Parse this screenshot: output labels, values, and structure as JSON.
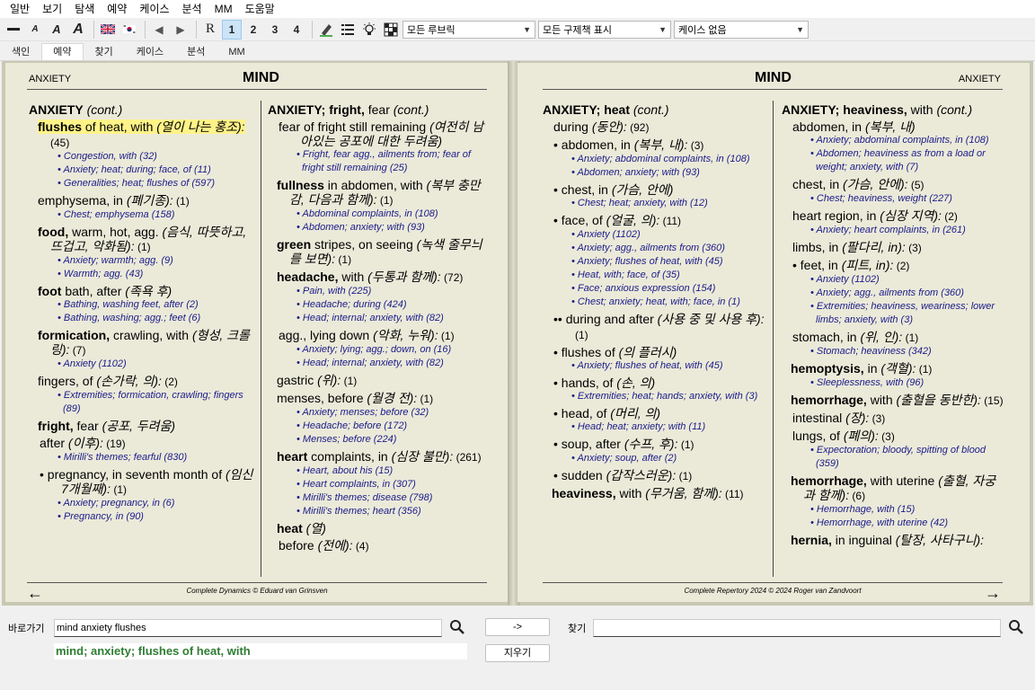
{
  "menu": [
    "일반",
    "보기",
    "탐색",
    "예약",
    "케이스",
    "분석",
    "MM",
    "도움말"
  ],
  "toolbar": {
    "r_label": "R",
    "num1": "1",
    "num2": "2",
    "num3": "3",
    "num4": "4",
    "rubric_filter": "모든 루브릭",
    "remedy_filter": "모든 구제책 표시",
    "case_select": "케이스 없음"
  },
  "tabs": [
    "색인",
    "예약",
    "찾기",
    "케이스",
    "분석",
    "MM"
  ],
  "left": {
    "header_small": "ANXIETY",
    "header_title": "MIND",
    "footer": "Complete Dynamics © Eduard van Grinsven",
    "col1": [
      {
        "t": "hd",
        "b": "ANXIETY",
        "r": " (cont.)"
      },
      {
        "t": "e",
        "hl": true,
        "b": "flushes",
        "p": " of heat, with ",
        "k": "(열이 나는 홍조):",
        "n": " (45)"
      },
      {
        "t": "x",
        "v": "• Congestion, with (32)"
      },
      {
        "t": "x",
        "v": "• Anxiety; heat; during; face, of (11)"
      },
      {
        "t": "x",
        "v": "• Generalities; heat; flushes of (597)"
      },
      {
        "t": "e",
        "p": "emphysema, in ",
        "k": "(폐기종):",
        "n": " (1)"
      },
      {
        "t": "x",
        "v": "• Chest; emphysema (158)"
      },
      {
        "t": "e",
        "b": "food,",
        "p": " warm, hot, agg. ",
        "k": "(음식, 따뜻하고, 뜨겁고, 악화됨):",
        "n": " (1)"
      },
      {
        "t": "x",
        "v": "• Anxiety; warmth; agg. (9)"
      },
      {
        "t": "x",
        "v": "• Warmth; agg. (43)"
      },
      {
        "t": "e",
        "b": "foot",
        "p": " bath, after ",
        "k": "(족욕 후)"
      },
      {
        "t": "x",
        "v": "• Bathing, washing feet, after (2)"
      },
      {
        "t": "x",
        "v": "• Bathing, washing; agg.; feet (6)"
      },
      {
        "t": "e",
        "b": "formication,",
        "p": " crawling, with ",
        "k": "(형성, 크롤링):",
        "n": " (7)"
      },
      {
        "t": "x",
        "v": "• Anxiety (1102)"
      },
      {
        "t": "e",
        "p": "fingers, of ",
        "k": "(손가락, 의):",
        "n": " (2)"
      },
      {
        "t": "x",
        "v": "• Extremities; formication, crawling; fingers (89)"
      },
      {
        "t": "e",
        "b": "fright,",
        "p": " fear ",
        "k": "(공포, 두려움)"
      },
      {
        "t": "s",
        "p": "after ",
        "k": "(이후):",
        "n": " (19)"
      },
      {
        "t": "x",
        "v": "• Mirilli's themes; fearful (830)"
      },
      {
        "t": "s",
        "p": "• pregnancy, in seventh month of ",
        "k": "(임신 7개월째):",
        "n": " (1)"
      },
      {
        "t": "x",
        "v": "• Anxiety; pregnancy, in (6)"
      },
      {
        "t": "x",
        "v": "• Pregnancy, in (90)"
      }
    ],
    "col2": [
      {
        "t": "hd",
        "b": "ANXIETY; fright,",
        "p": " fear",
        "r": " (cont.)"
      },
      {
        "t": "s",
        "p": "fear of fright still remaining ",
        "k": "(여전히 남아있는 공포에 대한 두려움)"
      },
      {
        "t": "x",
        "v": "• Fright, fear agg., ailments from; fear of fright still remaining (25)"
      },
      {
        "t": "e",
        "b": "fullness",
        "p": " in abdomen, with ",
        "k": "(복부 충만감, 다음과 함께):",
        "n": " (1)"
      },
      {
        "t": "x",
        "v": "• Abdominal complaints, in (108)"
      },
      {
        "t": "x",
        "v": "• Abdomen; anxiety; with (93)"
      },
      {
        "t": "e",
        "b": "green",
        "p": " stripes, on seeing ",
        "k": "(녹색 줄무늬를 보면):",
        "n": " (1)"
      },
      {
        "t": "e",
        "b": "headache,",
        "p": " with ",
        "k": "(두통과 함께):",
        "n": " (72)"
      },
      {
        "t": "x",
        "v": "• Pain, with (225)"
      },
      {
        "t": "x",
        "v": "• Headache; during (424)"
      },
      {
        "t": "x",
        "v": "• Head; internal; anxiety, with (82)"
      },
      {
        "t": "s",
        "p": "agg., lying down ",
        "k": "(악화, 누워):",
        "n": " (1)"
      },
      {
        "t": "x",
        "v": "• Anxiety; lying; agg.; down, on (16)"
      },
      {
        "t": "x",
        "v": "• Head; internal; anxiety, with (82)"
      },
      {
        "t": "e",
        "p": "gastric ",
        "k": "(위):",
        "n": " (1)"
      },
      {
        "t": "e",
        "p": "menses, before ",
        "k": "(월경 전):",
        "n": " (1)"
      },
      {
        "t": "x",
        "v": "• Anxiety; menses; before (32)"
      },
      {
        "t": "x",
        "v": "• Headache; before (172)"
      },
      {
        "t": "x",
        "v": "• Menses; before (224)"
      },
      {
        "t": "e",
        "b": "heart",
        "p": " complaints, in ",
        "k": "(심장 불만):",
        "n": " (261)"
      },
      {
        "t": "x",
        "v": "• Heart, about his (15)"
      },
      {
        "t": "x",
        "v": "• Heart complaints, in (307)"
      },
      {
        "t": "x",
        "v": "• Mirilli's themes; disease (798)"
      },
      {
        "t": "x",
        "v": "• Mirilli's themes; heart (356)"
      },
      {
        "t": "e",
        "b": "heat",
        "k": " (열)"
      },
      {
        "t": "s",
        "p": "before ",
        "k": "(전에):",
        "n": " (4)"
      }
    ]
  },
  "right": {
    "header_small": "ANXIETY",
    "header_title": "MIND",
    "footer": "Complete Repertory 2024 © 2024 Roger van Zandvoort",
    "col1": [
      {
        "t": "hd",
        "b": "ANXIETY; heat",
        "r": " (cont.)"
      },
      {
        "t": "s",
        "p": "during ",
        "k": "(동안):",
        "n": " (92)"
      },
      {
        "t": "s",
        "p": "• abdomen, in ",
        "k": "(복부, 내):",
        "n": " (3)"
      },
      {
        "t": "x",
        "v": "• Anxiety; abdominal complaints, in (108)"
      },
      {
        "t": "x",
        "v": "• Abdomen; anxiety; with (93)"
      },
      {
        "t": "s",
        "p": "• chest, in ",
        "k": "(가슴, 안에)"
      },
      {
        "t": "x",
        "v": "• Chest; heat; anxiety, with (12)"
      },
      {
        "t": "s",
        "p": "• face, of ",
        "k": "(얼굴, 의):",
        "n": " (11)"
      },
      {
        "t": "x",
        "v": "• Anxiety (1102)"
      },
      {
        "t": "x",
        "v": "• Anxiety; agg., ailments from (360)"
      },
      {
        "t": "x",
        "v": "• Anxiety; flushes of heat, with (45)"
      },
      {
        "t": "x",
        "v": "• Heat, with; face, of (35)"
      },
      {
        "t": "x",
        "v": "• Face; anxious expression (154)"
      },
      {
        "t": "x",
        "v": "• Chest; anxiety; heat, with; face, in (1)"
      },
      {
        "t": "s",
        "p": "•• during and after ",
        "k": "(사용 중 및 사용 후):",
        "n": " (1)"
      },
      {
        "t": "s",
        "p": "• flushes of ",
        "k": "(의 플러시)"
      },
      {
        "t": "x",
        "v": "• Anxiety; flushes of heat, with (45)"
      },
      {
        "t": "s",
        "p": "• hands, of ",
        "k": "(손, 의)"
      },
      {
        "t": "x",
        "v": "• Extremities; heat; hands; anxiety, with (3)"
      },
      {
        "t": "s",
        "p": "• head, of ",
        "k": "(머리, 의)"
      },
      {
        "t": "x",
        "v": "• Head; heat; anxiety; with (11)"
      },
      {
        "t": "s",
        "p": "• soup, after ",
        "k": "(수프, 후):",
        "n": " (1)"
      },
      {
        "t": "x",
        "v": "• Anxiety; soup, after (2)"
      },
      {
        "t": "s",
        "p": "• sudden ",
        "k": "(갑작스러운):",
        "n": " (1)"
      },
      {
        "t": "e",
        "b": "heaviness,",
        "p": " with ",
        "k": "(무거움, 함께):",
        "n": "   (11)"
      }
    ],
    "col2": [
      {
        "t": "hd",
        "b": "ANXIETY; heaviness,",
        "p": " with",
        "r": " (cont.)"
      },
      {
        "t": "s",
        "p": "abdomen, in ",
        "k": "(복부, 내)"
      },
      {
        "t": "x",
        "v": "• Anxiety; abdominal complaints, in (108)"
      },
      {
        "t": "x",
        "v": "• Abdomen; heaviness as from a load or weight; anxiety, with (7)"
      },
      {
        "t": "s",
        "p": "chest, in ",
        "k": "(가슴, 안에):",
        "n": " (5)"
      },
      {
        "t": "x",
        "v": "• Chest; heaviness, weight (227)"
      },
      {
        "t": "s",
        "p": "heart region, in ",
        "k": "(심장 지역):",
        "n": " (2)"
      },
      {
        "t": "x",
        "v": "• Anxiety; heart complaints, in (261)"
      },
      {
        "t": "s",
        "p": "limbs, in ",
        "k": "(팔다리, in):",
        "n": " (3)"
      },
      {
        "t": "s",
        "p": "• feet, in ",
        "k": "(피트, in):",
        "n": " (2)"
      },
      {
        "t": "x",
        "v": "• Anxiety (1102)"
      },
      {
        "t": "x",
        "v": "• Anxiety; agg., ailments from (360)"
      },
      {
        "t": "x",
        "v": "• Extremities; heaviness, weariness; lower limbs; anxiety, with (3)"
      },
      {
        "t": "s",
        "p": "stomach, in ",
        "k": "(위, 인):",
        "n": " (1)"
      },
      {
        "t": "x",
        "v": "• Stomach; heaviness (342)"
      },
      {
        "t": "e",
        "b": "hemoptysis,",
        "p": " in ",
        "k": "(객혈):",
        "n": " (1)"
      },
      {
        "t": "x",
        "v": "• Sleeplessness, with (96)"
      },
      {
        "t": "e",
        "b": "hemorrhage,",
        "p": " with ",
        "k": "(출혈을 동반한):",
        "n": " (15)"
      },
      {
        "t": "s",
        "p": "intestinal ",
        "k": "(장):",
        "n": " (3)"
      },
      {
        "t": "s",
        "p": "lungs, of ",
        "k": "(폐의):",
        "n": " (3)"
      },
      {
        "t": "x",
        "v": "• Expectoration; bloody, spitting of blood (359)"
      },
      {
        "t": "e",
        "b": "hemorrhage,",
        "p": " with uterine ",
        "k": "(출혈, 자궁과 함께):",
        "n": " (6)"
      },
      {
        "t": "x",
        "v": "• Hemorrhage, with (15)"
      },
      {
        "t": "x",
        "v": "• Hemorrhage, with uterine (42)"
      },
      {
        "t": "e",
        "b": "hernia,",
        "p": " in inguinal ",
        "k": "(탈장, 사타구니):"
      }
    ]
  },
  "bottom": {
    "goto_label": "바로가기",
    "goto_value": "mind anxiety flushes",
    "go_button": "->",
    "find_label": "찾기",
    "find_value": "",
    "clear_button": "지우기",
    "crumb": [
      {
        "v": "mind",
        "c": "#2e7d32"
      },
      {
        "v": "; ",
        "c": "#2e7d32"
      },
      {
        "v": "anxiety",
        "c": "#2e7d32"
      },
      {
        "v": "; ",
        "c": "#2e7d32"
      },
      {
        "v": "flushes of heat, with",
        "c": "#2e7d32"
      }
    ]
  }
}
